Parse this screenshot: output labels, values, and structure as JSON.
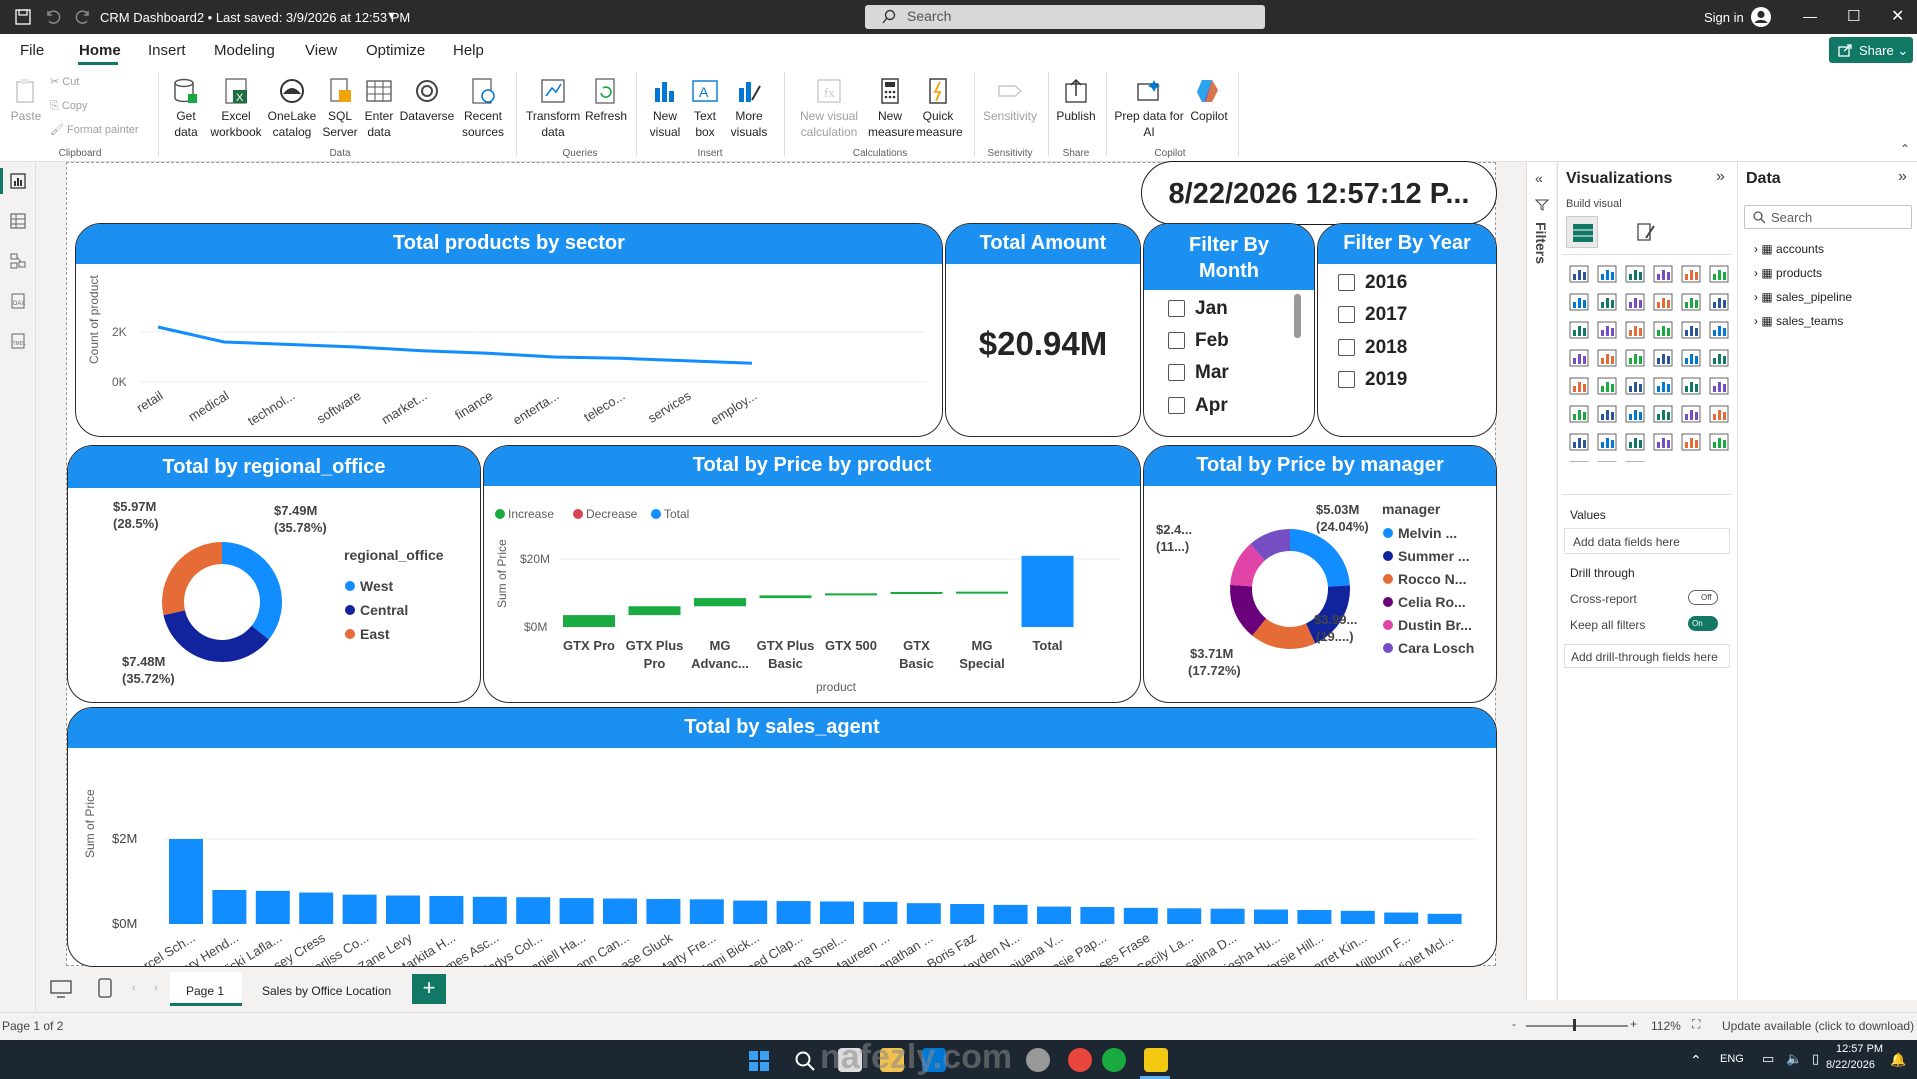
{
  "window": {
    "title": "CRM Dashboard2 • Last saved: 3/9/2026 at 12:53 PM",
    "search_placeholder": "Search",
    "signin": "Sign in",
    "share": "Share"
  },
  "menu": [
    "File",
    "Home",
    "Insert",
    "Modeling",
    "View",
    "Optimize",
    "Help"
  ],
  "ribbon": {
    "clipboard": {
      "paste": "Paste",
      "cut": "Cut",
      "copy": "Copy",
      "format_painter": "Format painter",
      "label": "Clipboard"
    },
    "data": {
      "get_data": "Get data",
      "excel": "Excel workbook",
      "onelake": "OneLake catalog",
      "sql": "SQL Server",
      "enter": "Enter data",
      "dataverse": "Dataverse",
      "recent": "Recent sources",
      "label": "Data"
    },
    "queries": {
      "transform": "Transform data",
      "refresh": "Refresh",
      "label": "Queries"
    },
    "insert": {
      "new_visual": "New visual",
      "text_box": "Text box",
      "more_visuals": "More visuals",
      "label": "Insert"
    },
    "calculations": {
      "new_visual_calc": "New visual calculation",
      "new_measure": "New measure",
      "quick_measure": "Quick measure",
      "label": "Calculations"
    },
    "sensitivity": {
      "sensitivity": "Sensitivity",
      "label": "Sensitivity"
    },
    "share": {
      "publish": "Publish",
      "label": "Share"
    },
    "copilot": {
      "prep": "Prep data for AI",
      "copilot": "Copilot",
      "label": "Copilot"
    }
  },
  "datetime_card": "8/22/2026 12:57:12 P...",
  "line_card": {
    "title": "Total products by sector"
  },
  "total_amount": {
    "title": "Total Amount",
    "value": "$20.94M"
  },
  "filter_month": {
    "title_line1": "Filter By",
    "title_line2": "Month",
    "items": [
      "Jan",
      "Feb",
      "Mar",
      "Apr"
    ]
  },
  "filter_year": {
    "title": "Filter By Year",
    "items": [
      "2016",
      "2017",
      "2018",
      "2019"
    ]
  },
  "regional_card": {
    "title": "Total by regional_office",
    "legend_title": "regional_office"
  },
  "waterfall_card": {
    "title": "Total by Price by product"
  },
  "manager_card": {
    "title": "Total by Price by manager",
    "legend_title": "manager"
  },
  "agent_card": {
    "title": "Total by sales_agent"
  },
  "chart_data": [
    {
      "type": "line",
      "title": "Total products by sector",
      "ylabel": "Count of product",
      "xlabel": "",
      "categories": [
        "retail",
        "medical",
        "technol...",
        "software",
        "market...",
        "finance",
        "enterta...",
        "teleco...",
        "services",
        "employ..."
      ],
      "values": [
        2200,
        1600,
        1500,
        1400,
        1250,
        1150,
        1000,
        950,
        850,
        750
      ],
      "yticks": [
        "0K",
        "2K"
      ],
      "ylim": [
        0,
        2600
      ]
    },
    {
      "type": "pie",
      "title": "Total by regional_office",
      "donut": true,
      "legend": [
        {
          "name": "West",
          "value": 7.49,
          "label": "$7.49M",
          "pct": "(35.78%)",
          "color": "#118DFF"
        },
        {
          "name": "Central",
          "value": 7.48,
          "label": "$7.48M",
          "pct": "(35.72%)",
          "color": "#12239E"
        },
        {
          "name": "East",
          "value": 5.97,
          "label": "$5.97M",
          "pct": "(28.5%)",
          "color": "#E66C37"
        }
      ]
    },
    {
      "type": "bar",
      "subtype": "waterfall",
      "title": "Total by Price by product",
      "xlabel": "product",
      "ylabel": "Sum of Price",
      "legend": [
        {
          "name": "Increase",
          "color": "#1AAB40"
        },
        {
          "name": "Decrease",
          "color": "#D64554"
        },
        {
          "name": "Total",
          "color": "#118DFF"
        }
      ],
      "categories": [
        "GTX Pro",
        "GTX Plus Pro",
        "MG Advanc...",
        "GTX Plus Basic",
        "GTX 500",
        "GTX Basic",
        "MG Special",
        "Total"
      ],
      "cat_lines": [
        [
          "GTX Pro"
        ],
        [
          "GTX Plus",
          "Pro"
        ],
        [
          "MG",
          "Advanc..."
        ],
        [
          "GTX Plus",
          "Basic"
        ],
        [
          "GTX 500"
        ],
        [
          "GTX",
          "Basic"
        ],
        [
          "MG",
          "Special"
        ],
        [
          "Total"
        ]
      ],
      "values": [
        3.5,
        2.6,
        2.4,
        0.8,
        0.6,
        0.4,
        0.1,
        20.94
      ],
      "yticks": [
        "$0M",
        "$20M"
      ],
      "ylim": [
        0,
        24
      ]
    },
    {
      "type": "pie",
      "title": "Total by Price by manager",
      "donut": true,
      "legend_names": [
        "Melvin ...",
        "Summer ...",
        "Rocco N...",
        "Celia Ro...",
        "Dustin Br...",
        "Cara Losch"
      ],
      "legend_colors": [
        "#118DFF",
        "#12239E",
        "#E66C37",
        "#6B007B",
        "#E044A7",
        "#744EC2"
      ],
      "slices": [
        {
          "name": "Melvin ...",
          "value": 5.03,
          "label": "$5.03M",
          "pct": "(24.04%)"
        },
        {
          "name": "Summer ...",
          "value": 3.99,
          "label": "$3.99...",
          "pct": "(19....)"
        },
        {
          "name": "Rocco N...",
          "value": 3.71,
          "label": "$3.71M",
          "pct": "(17.72%)"
        },
        {
          "name": "Celia Ro...",
          "value": 3.2
        },
        {
          "name": "Dustin Br...",
          "value": 2.6
        },
        {
          "name": "Cara Losch",
          "value": 2.4,
          "label": "$2.4...",
          "pct": "(11...)"
        }
      ]
    },
    {
      "type": "bar",
      "title": "Total by sales_agent",
      "ylabel": "Sum of Price",
      "yticks": [
        "$0M",
        "$2M"
      ],
      "ylim": [
        0,
        2.5
      ],
      "categories": [
        "Darcel Sch...",
        "Kary Hend...",
        "Vicki Lafla...",
        "Cassey Cress",
        "Corliss Co...",
        "Zane Levy",
        "Markita H...",
        "James Asc...",
        "Gladys Col...",
        "Daniell Ha...",
        "Donn Can...",
        "Elease Gluck",
        "Marty Fre...",
        "Kami Bick...",
        "Reed Clap...",
        "Anna Snel...",
        "Maureen ...",
        "Jonathan ...",
        "Boris Faz",
        "Hayden N...",
        "Lajuana V...",
        "Rosie Pap...",
        "Moses Frase",
        "Cecily La...",
        "Rosalina D...",
        "Niesha Hu...",
        "Versie Hill...",
        "Garret Kin...",
        "Wilburn F...",
        "Violet Mcl..."
      ],
      "values": [
        2.0,
        0.8,
        0.78,
        0.74,
        0.69,
        0.67,
        0.66,
        0.64,
        0.63,
        0.61,
        0.6,
        0.59,
        0.58,
        0.55,
        0.54,
        0.53,
        0.52,
        0.49,
        0.47,
        0.45,
        0.41,
        0.4,
        0.38,
        0.37,
        0.36,
        0.34,
        0.33,
        0.31,
        0.27,
        0.24
      ]
    }
  ],
  "panes": {
    "filters": "Filters",
    "visualizations": "Visualizations",
    "build_visual": "Build visual",
    "data": "Data",
    "data_search": "Search",
    "values": "Values",
    "add_data_fields": "Add data fields here",
    "drill_through": "Drill through",
    "cross_report": "Cross-report",
    "cross_report_state": "Off",
    "keep_all_filters": "Keep all filters",
    "keep_state": "On",
    "add_drill": "Add drill-through fields here",
    "tables": [
      "accounts",
      "products",
      "sales_pipeline",
      "sales_teams"
    ]
  },
  "pages": {
    "page1": "Page 1",
    "page2": "Sales by Office Location"
  },
  "status": {
    "page": "Page 1 of 2",
    "zoom": "112%",
    "update": "Update available (click to download)"
  },
  "taskbar": {
    "lang": "ENG",
    "time": "12:57 PM",
    "date": "8/22/2026"
  },
  "watermark": "nafezly.com"
}
